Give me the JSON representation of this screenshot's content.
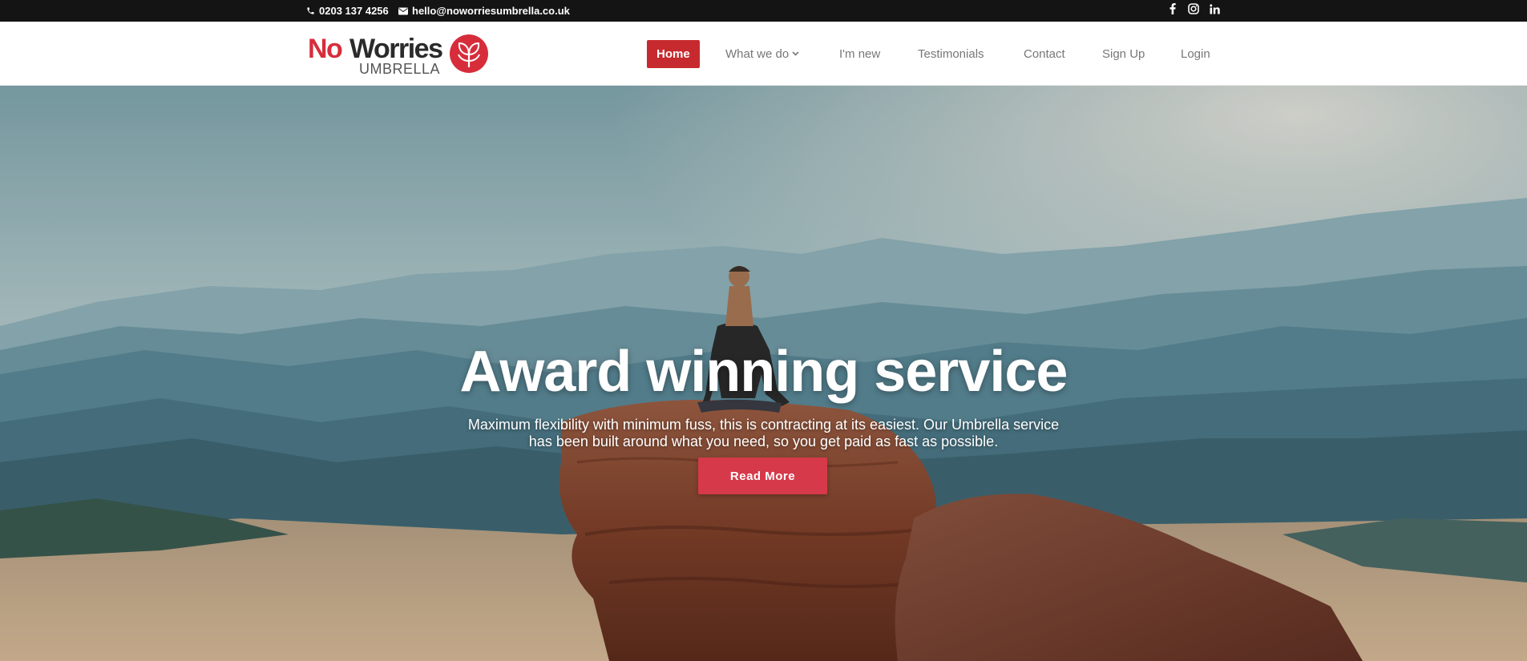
{
  "topbar": {
    "phone": "0203 137 4256",
    "email": "hello@noworriesumbrella.co.uk",
    "social": [
      "facebook-icon",
      "instagram-icon",
      "linkedin-icon"
    ]
  },
  "header": {
    "logo": {
      "word1": "No",
      "word2": "Worries",
      "word3": "UMBRELLA"
    },
    "nav": {
      "home": "Home",
      "what_we_do": "What we do",
      "im_new": "I'm new",
      "testimonials": "Testimonials",
      "contact": "Contact",
      "sign_up": "Sign Up",
      "login": "Login"
    }
  },
  "hero": {
    "title": "Award winning service",
    "subtitle": "Maximum flexibility with minimum fuss, this is contracting at its easiest. Our Umbrella service has been built around what you need, so you get paid as fast as possible.",
    "button": "Read More"
  },
  "colors": {
    "brand_red": "#d72d3b",
    "nav_active": "#c72a2e",
    "button": "#d63a4a",
    "topbar": "#141414"
  }
}
